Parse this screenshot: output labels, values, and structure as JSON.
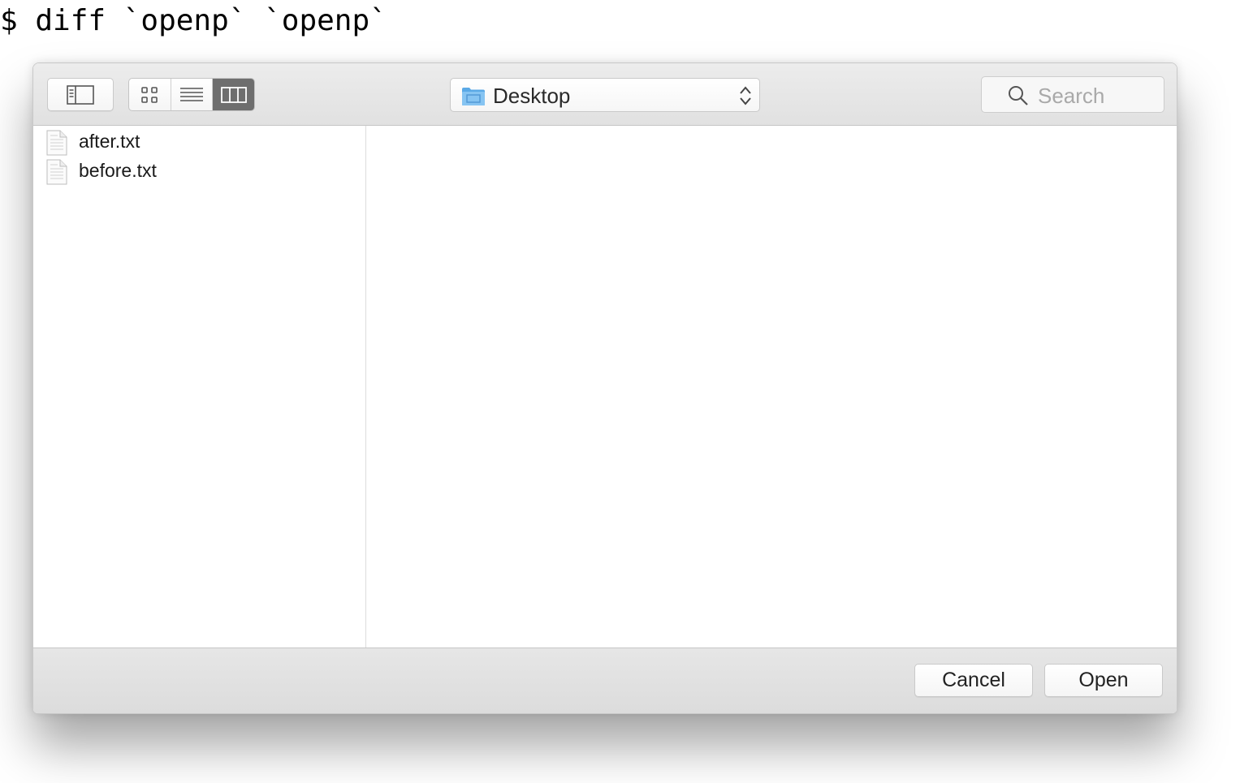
{
  "terminal": {
    "command": "$ diff `openp` `openp`"
  },
  "dialog": {
    "toolbar": {
      "location": "Desktop",
      "search_placeholder": "Search"
    },
    "files": [
      {
        "name": "after.txt"
      },
      {
        "name": "before.txt"
      }
    ],
    "footer": {
      "cancel_label": "Cancel",
      "open_label": "Open"
    }
  },
  "colors": {
    "folder_blue": "#6fb4ea",
    "active_segment": "#6e6e6e"
  },
  "icons": [
    "sidebar-toggle-icon",
    "icon-view-icon",
    "list-view-icon",
    "column-view-icon",
    "folder-icon",
    "up-down-chevron-icon",
    "search-icon",
    "text-file-icon"
  ]
}
